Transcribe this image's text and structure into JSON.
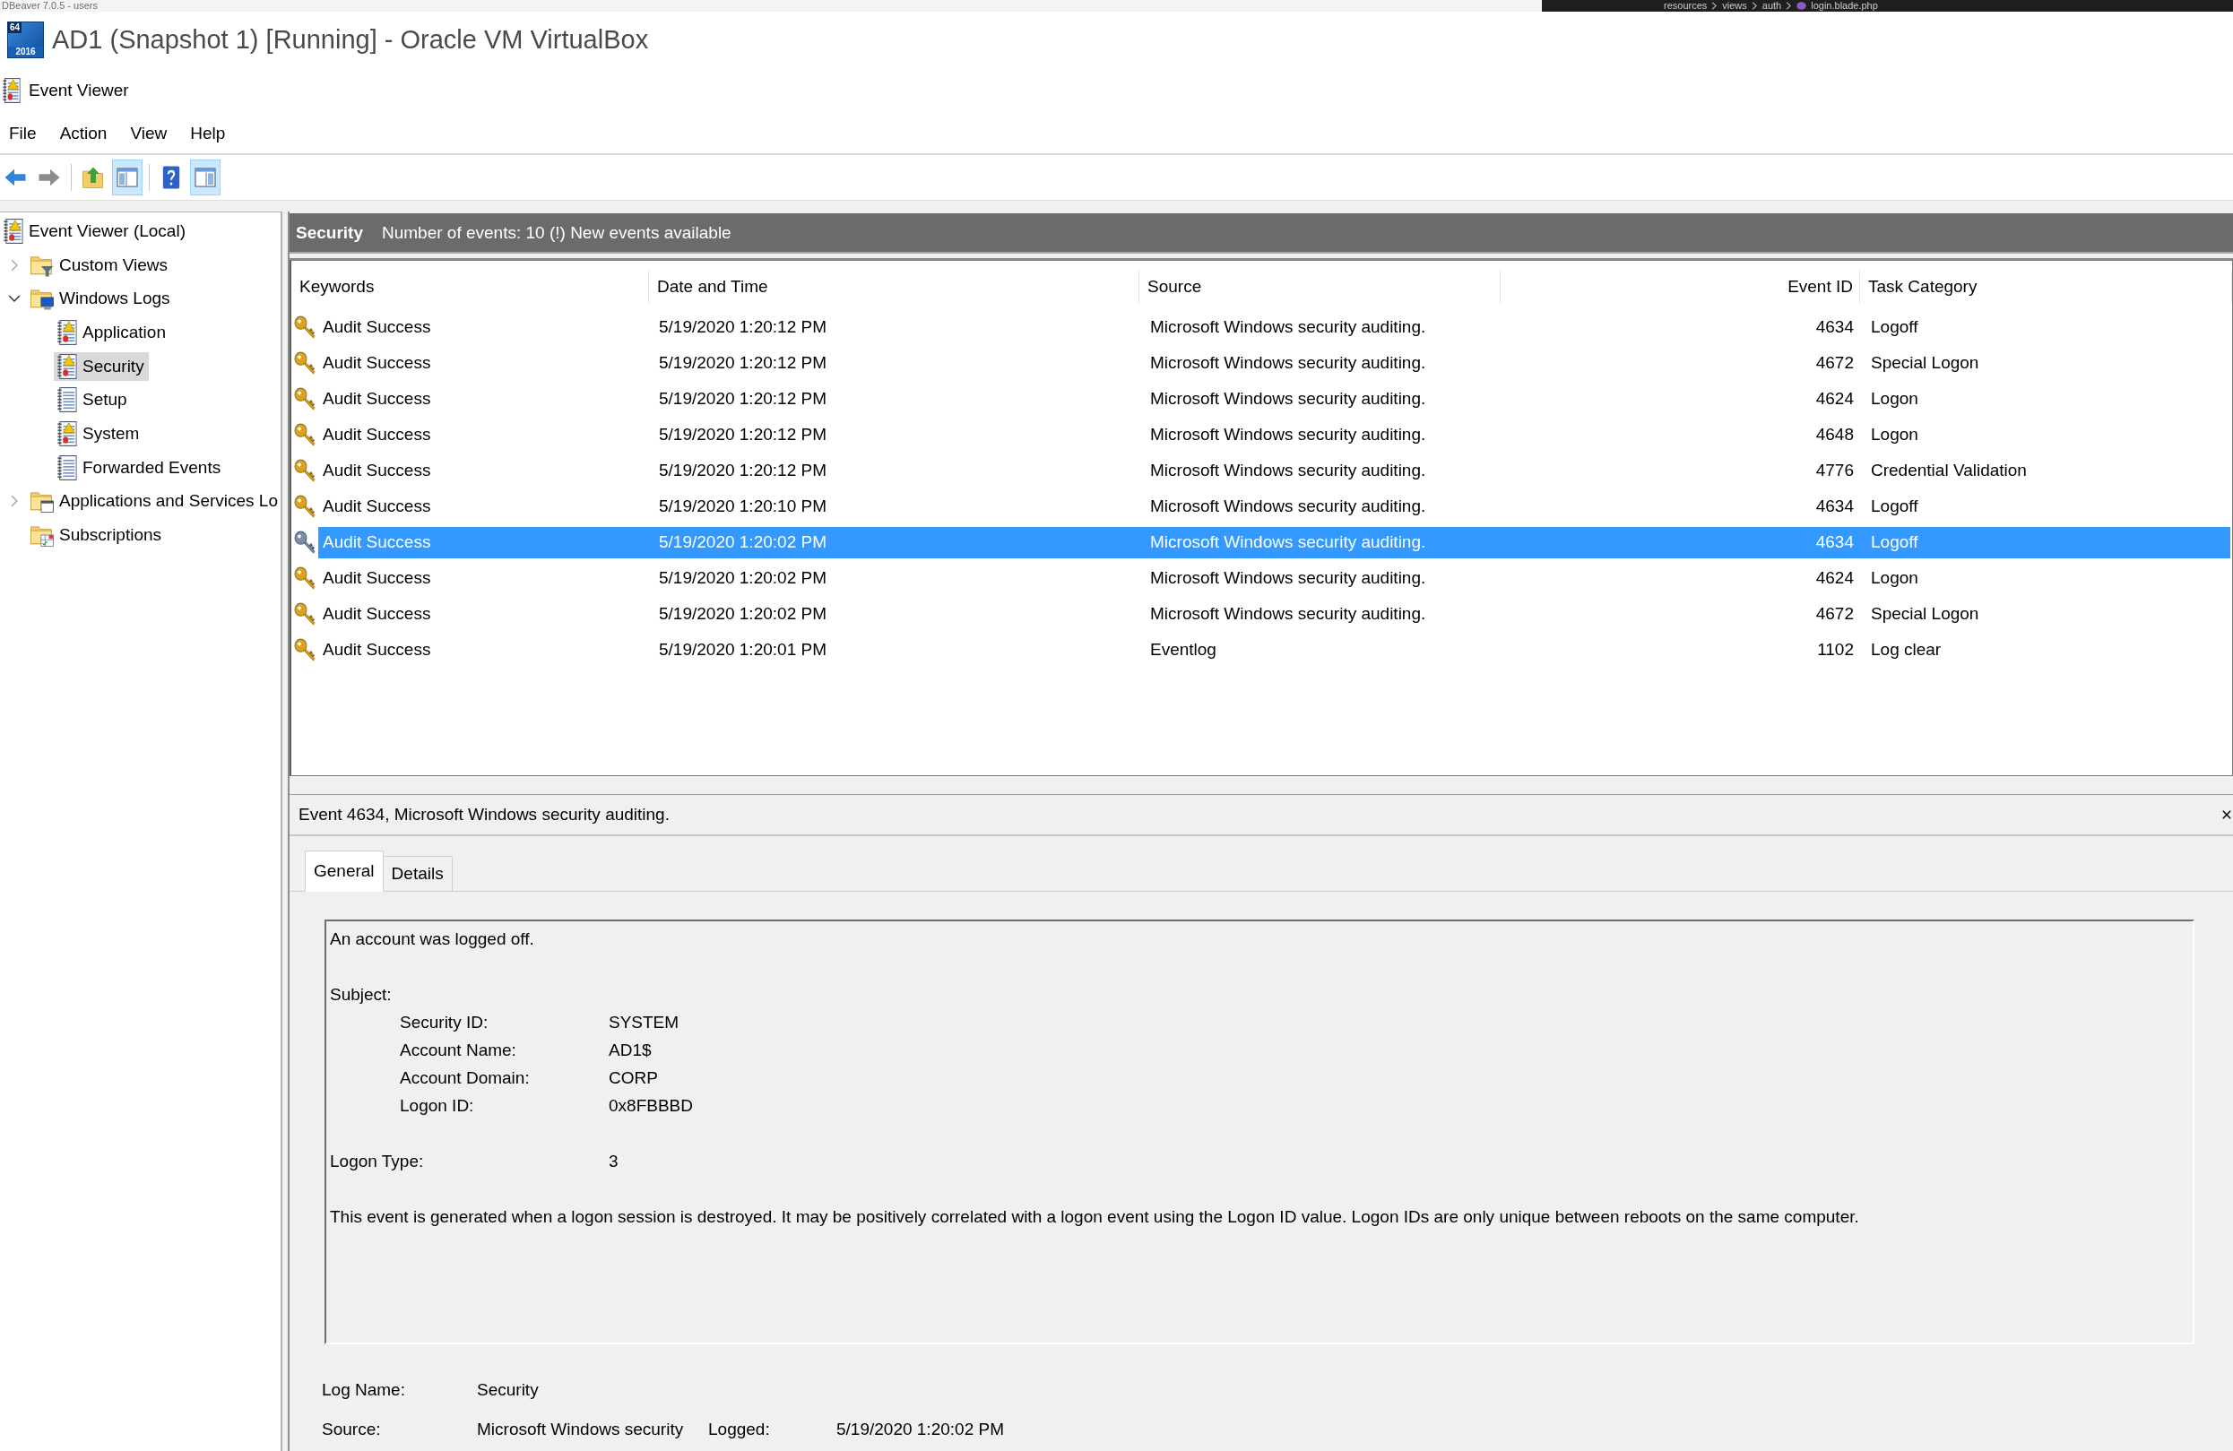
{
  "top_strip": {
    "left_title": "DBeaver 7.0.5 - users",
    "breadcrumb": [
      "resources",
      "views",
      "auth",
      "login.blade.php"
    ]
  },
  "window": {
    "title": "AD1 (Snapshot 1) [Running] - Oracle VM VirtualBox",
    "os_badge": {
      "bits": "64",
      "year": "2016"
    }
  },
  "app": {
    "title": "Event Viewer"
  },
  "menu": [
    "File",
    "Action",
    "View",
    "Help"
  ],
  "toolbar": {
    "groups": [
      [
        {
          "kind": "back",
          "disabled": false,
          "pressed": false
        },
        {
          "kind": "forward",
          "disabled": true,
          "pressed": false
        }
      ],
      [
        {
          "kind": "up",
          "disabled": false,
          "pressed": false
        },
        {
          "kind": "tree",
          "disabled": false,
          "pressed": true
        }
      ],
      [
        {
          "kind": "help",
          "disabled": false,
          "pressed": false
        },
        {
          "kind": "actions",
          "disabled": false,
          "pressed": true
        }
      ]
    ]
  },
  "tree": [
    {
      "label": "Event Viewer (Local)",
      "kind": "console",
      "selected": false,
      "children": [
        {
          "label": "Custom Views",
          "kind": "filter",
          "expanded": false,
          "selected": false
        },
        {
          "label": "Windows Logs",
          "kind": "computer",
          "expanded": true,
          "selected": false,
          "children": [
            {
              "label": "Application",
              "kind": "alertlog",
              "selected": false
            },
            {
              "label": "Security",
              "kind": "alertlog",
              "selected": true
            },
            {
              "label": "Setup",
              "kind": "plainlog",
              "selected": false
            },
            {
              "label": "System",
              "kind": "alertlog",
              "selected": false
            },
            {
              "label": "Forwarded Events",
              "kind": "plainlog",
              "selected": false
            }
          ]
        },
        {
          "label": "Applications and Services Lo",
          "kind": "window",
          "expanded": false,
          "selected": false
        },
        {
          "label": "Subscriptions",
          "kind": "subscription",
          "selected": false
        }
      ]
    }
  ],
  "log_header": {
    "name": "Security",
    "summary": "Number of events: 10 (!) New events available"
  },
  "table": {
    "columns": [
      "Keywords",
      "Date and Time",
      "Source",
      "Event ID",
      "Task Category"
    ],
    "rows": [
      {
        "keywords": "Audit Success",
        "date_time": "5/19/2020 1:20:12 PM",
        "source": "Microsoft Windows security auditing.",
        "event_id": "4634",
        "task_category": "Logoff",
        "selected": false
      },
      {
        "keywords": "Audit Success",
        "date_time": "5/19/2020 1:20:12 PM",
        "source": "Microsoft Windows security auditing.",
        "event_id": "4672",
        "task_category": "Special Logon",
        "selected": false
      },
      {
        "keywords": "Audit Success",
        "date_time": "5/19/2020 1:20:12 PM",
        "source": "Microsoft Windows security auditing.",
        "event_id": "4624",
        "task_category": "Logon",
        "selected": false
      },
      {
        "keywords": "Audit Success",
        "date_time": "5/19/2020 1:20:12 PM",
        "source": "Microsoft Windows security auditing.",
        "event_id": "4648",
        "task_category": "Logon",
        "selected": false
      },
      {
        "keywords": "Audit Success",
        "date_time": "5/19/2020 1:20:12 PM",
        "source": "Microsoft Windows security auditing.",
        "event_id": "4776",
        "task_category": "Credential Validation",
        "selected": false
      },
      {
        "keywords": "Audit Success",
        "date_time": "5/19/2020 1:20:10 PM",
        "source": "Microsoft Windows security auditing.",
        "event_id": "4634",
        "task_category": "Logoff",
        "selected": false
      },
      {
        "keywords": "Audit Success",
        "date_time": "5/19/2020 1:20:02 PM",
        "source": "Microsoft Windows security auditing.",
        "event_id": "4634",
        "task_category": "Logoff",
        "selected": true
      },
      {
        "keywords": "Audit Success",
        "date_time": "5/19/2020 1:20:02 PM",
        "source": "Microsoft Windows security auditing.",
        "event_id": "4624",
        "task_category": "Logon",
        "selected": false
      },
      {
        "keywords": "Audit Success",
        "date_time": "5/19/2020 1:20:02 PM",
        "source": "Microsoft Windows security auditing.",
        "event_id": "4672",
        "task_category": "Special Logon",
        "selected": false
      },
      {
        "keywords": "Audit Success",
        "date_time": "5/19/2020 1:20:01 PM",
        "source": "Eventlog",
        "event_id": "1102",
        "task_category": "Log clear",
        "selected": false
      }
    ]
  },
  "detail": {
    "title": "Event 4634, Microsoft Windows security auditing.",
    "tabs": [
      {
        "label": "General",
        "selected": true
      },
      {
        "label": "Details",
        "selected": false
      }
    ],
    "description": {
      "summary": "An account was logged off.",
      "subject_heading": "Subject:",
      "subject_fields": [
        {
          "label": "Security ID:",
          "value": "SYSTEM"
        },
        {
          "label": "Account Name:",
          "value": "AD1$"
        },
        {
          "label": "Account Domain:",
          "value": "CORP"
        },
        {
          "label": "Logon ID:",
          "value": "0x8FBBBD"
        }
      ],
      "logon_type": {
        "label": "Logon Type:",
        "value": "3"
      },
      "explanation": "This event is generated when a logon session is destroyed. It may be positively correlated with a logon event using the Logon ID value. Logon IDs are only unique between reboots on the same computer."
    },
    "properties": [
      [
        {
          "label": "Log Name:",
          "value": "Security"
        }
      ],
      [
        {
          "label": "Source:",
          "value": "Microsoft Windows security"
        },
        {
          "label": "Logged:",
          "value": "5/19/2020 1:20:02 PM"
        }
      ]
    ]
  }
}
